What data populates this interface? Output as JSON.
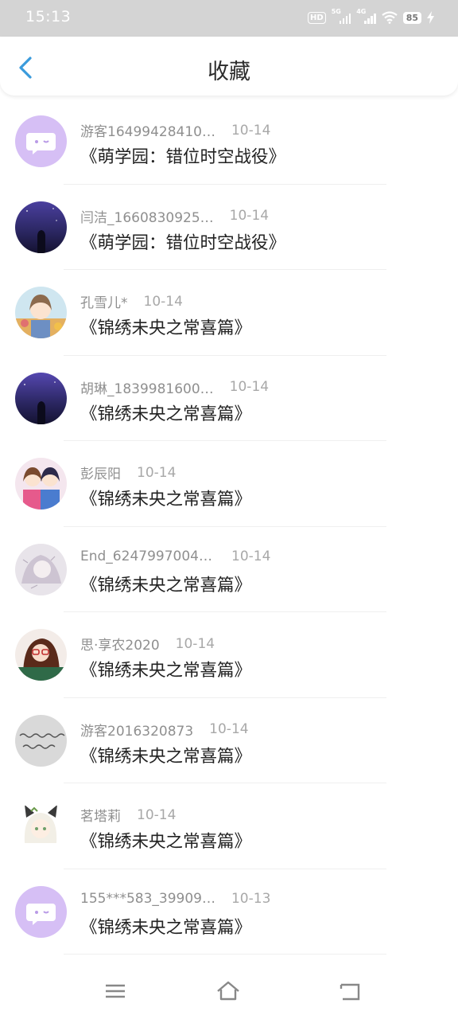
{
  "status": {
    "time": "15:13",
    "hd_label": "HD",
    "net1": "5G",
    "net2": "4G",
    "battery": "85"
  },
  "header": {
    "title": "收藏"
  },
  "favorites": [
    {
      "name": "游客16499428410…",
      "date": "10-14",
      "work": "《萌学园：错位时空战役》",
      "avatar": "purple-chat-avatar"
    },
    {
      "name": "闫洁_1660830925…",
      "date": "10-14",
      "work": "《萌学园：错位时空战役》",
      "avatar": "night-sky-avatar"
    },
    {
      "name": "孔雪儿*",
      "date": "10-14",
      "work": "《锦绣未央之常喜篇》",
      "avatar": "anime-girl-avatar"
    },
    {
      "name": "胡琳_1839981600…",
      "date": "10-14",
      "work": "《锦绣未央之常喜篇》",
      "avatar": "night-sky-avatar"
    },
    {
      "name": "彭辰阳",
      "date": "10-14",
      "work": "《锦绣未央之常喜篇》",
      "avatar": "anime-pair-avatar"
    },
    {
      "name": "End_62479970040…",
      "date": "10-14",
      "work": "《锦绣未央之常喜篇》",
      "avatar": "sketch-girl-avatar"
    },
    {
      "name": "思·享农2020",
      "date": "10-14",
      "work": "《锦绣未央之常喜篇》",
      "avatar": "glasses-girl-avatar"
    },
    {
      "name": "游客2016320873",
      "date": "10-14",
      "work": "《锦绣未央之常喜篇》",
      "avatar": "handwriting-avatar"
    },
    {
      "name": "茗塔莉",
      "date": "10-14",
      "work": "《锦绣未央之常喜篇》",
      "avatar": "cat-ear-girl-avatar"
    },
    {
      "name": "155***583_39909…",
      "date": "10-13",
      "work": "《锦绣未央之常喜篇》",
      "avatar": "purple-chat-avatar"
    }
  ],
  "avatar_text": {
    "handwriting": "这是我选择的 我错过了"
  },
  "nav": {
    "menu_icon": "menu-icon",
    "home_icon": "home-icon",
    "back_icon": "back-nav-icon"
  },
  "colors": {
    "accent": "#3a9bdc",
    "avatar_purple": "#d6bff5"
  }
}
